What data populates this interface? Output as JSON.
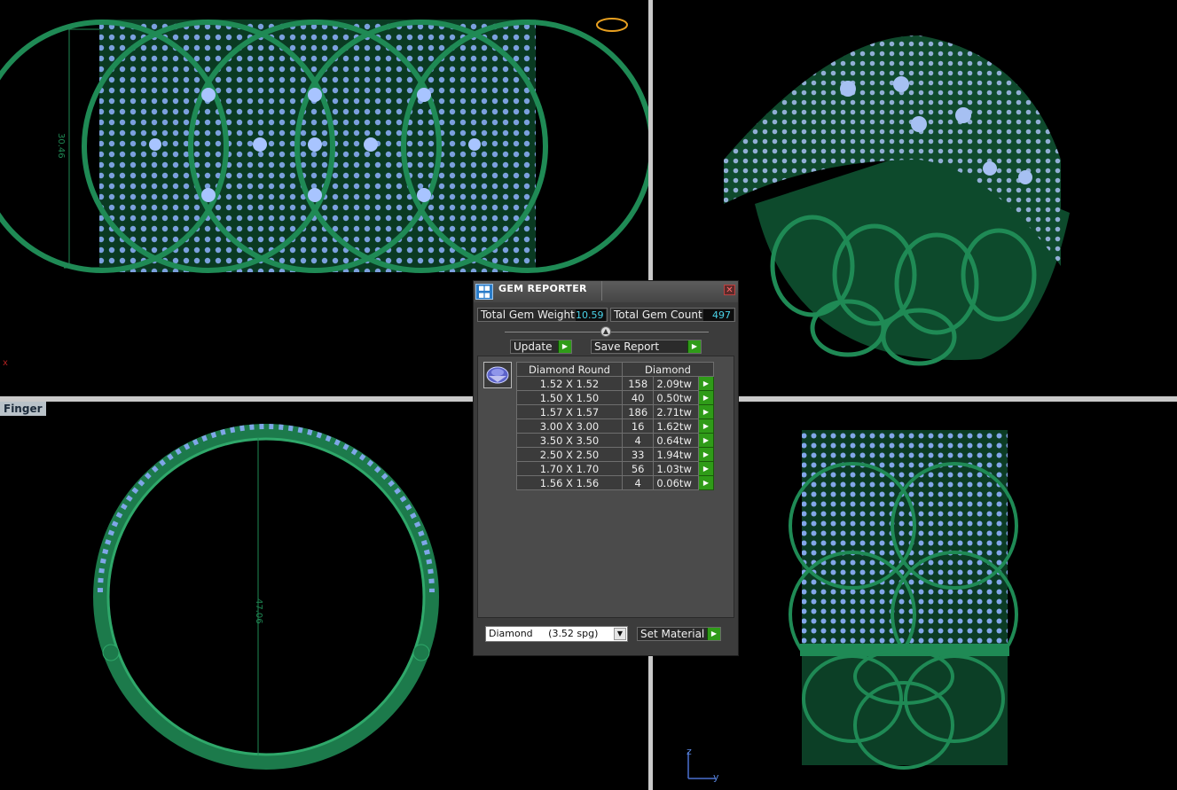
{
  "viewports": {
    "bottom_left_label": "Finger",
    "front_dimension": "30.46",
    "finger_dimension": "47.06",
    "axes": {
      "z": "z",
      "y": "y",
      "x": "x"
    }
  },
  "colors": {
    "metal": "#1f8a55",
    "gem": "#8fb2ff",
    "background": "#000000"
  },
  "dialog": {
    "title": "GEM REPORTER",
    "close_icon": "close-icon",
    "total_weight_label": "Total Gem Weight",
    "total_weight_value": "10.59",
    "total_count_label": "Total Gem Count",
    "total_count_value": "497",
    "update_label": "Update",
    "save_report_label": "Save Report",
    "table": {
      "col_shape": "Diamond Round",
      "col_material": "Diamond",
      "rows": [
        {
          "size": "1.52 X 1.52",
          "count": "158",
          "weight": "2.09tw"
        },
        {
          "size": "1.50 X 1.50",
          "count": "40",
          "weight": "0.50tw"
        },
        {
          "size": "1.57 X 1.57",
          "count": "186",
          "weight": "2.71tw"
        },
        {
          "size": "3.00 X 3.00",
          "count": "16",
          "weight": "1.62tw"
        },
        {
          "size": "3.50 X 3.50",
          "count": "4",
          "weight": "0.64tw"
        },
        {
          "size": "2.50 X 2.50",
          "count": "33",
          "weight": "1.94tw"
        },
        {
          "size": "1.70 X 1.70",
          "count": "56",
          "weight": "1.03tw"
        },
        {
          "size": "1.56 X 1.56",
          "count": "4",
          "weight": "0.06tw"
        }
      ]
    },
    "material_select": "Diamond     (3.52 spg)",
    "set_material_label": "Set Material"
  }
}
